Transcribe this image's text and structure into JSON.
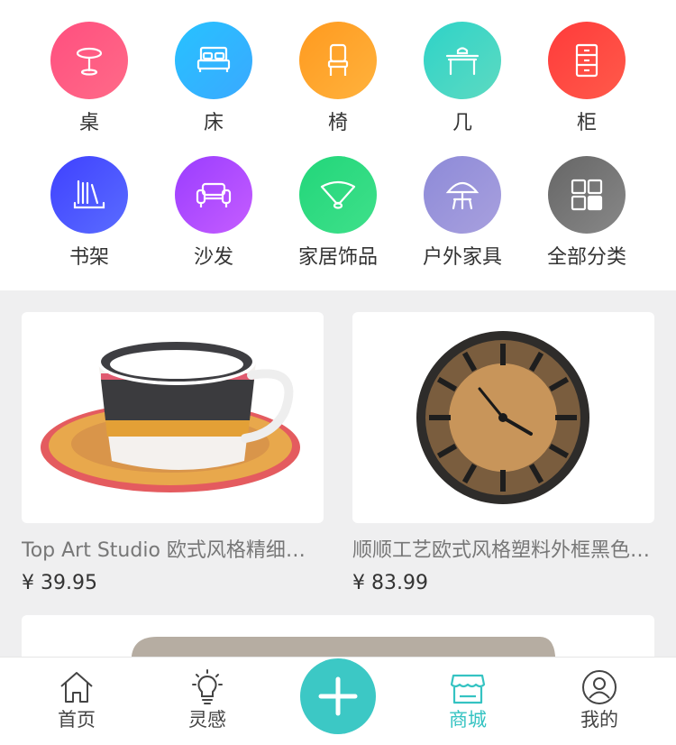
{
  "categories": [
    {
      "label": "桌",
      "icon": "round-table-icon",
      "gradient": [
        "#ff4f7f",
        "#ff6a88"
      ]
    },
    {
      "label": "床",
      "icon": "bed-icon",
      "gradient": [
        "#27c2ff",
        "#3aa9ff"
      ]
    },
    {
      "label": "椅",
      "icon": "chair-icon",
      "gradient": [
        "#ff9a1f",
        "#ffb23d"
      ]
    },
    {
      "label": "几",
      "icon": "tea-table-icon",
      "gradient": [
        "#2ed3c8",
        "#5ddac1"
      ]
    },
    {
      "label": "柜",
      "icon": "cabinet-icon",
      "gradient": [
        "#ff3b3b",
        "#ff5a4a"
      ]
    },
    {
      "label": "书架",
      "icon": "bookshelf-icon",
      "gradient": [
        "#3f41ff",
        "#5a6cff"
      ]
    },
    {
      "label": "沙发",
      "icon": "sofa-icon",
      "gradient": [
        "#9a3dff",
        "#c55dff"
      ]
    },
    {
      "label": "家居饰品",
      "icon": "fan-decor-icon",
      "gradient": [
        "#22d67a",
        "#3fe08a"
      ]
    },
    {
      "label": "户外家具",
      "icon": "umbrella-icon",
      "gradient": [
        "#8d8ad8",
        "#a8a0de"
      ]
    },
    {
      "label": "全部分类",
      "icon": "grid-icon",
      "gradient": [
        "#666",
        "#888"
      ]
    }
  ],
  "products": [
    {
      "title": "Top Art Studio 欧式风格精细骨瓷咖啡杯碟套装",
      "price": "¥ 39.95",
      "image": "teacup-image"
    },
    {
      "title": "顺顺工艺欧式风格塑料外框黑色复古挂钟",
      "price": "¥ 83.99",
      "image": "wall-clock-image"
    }
  ],
  "tabs": [
    {
      "label": "首页",
      "icon": "home-icon"
    },
    {
      "label": "灵感",
      "icon": "lightbulb-icon"
    },
    {
      "label": "商城",
      "icon": "store-icon",
      "active": true
    },
    {
      "label": "我的",
      "icon": "user-icon"
    }
  ],
  "colors": {
    "accent": "#35c3c2",
    "plus": "#3cc8c5"
  }
}
